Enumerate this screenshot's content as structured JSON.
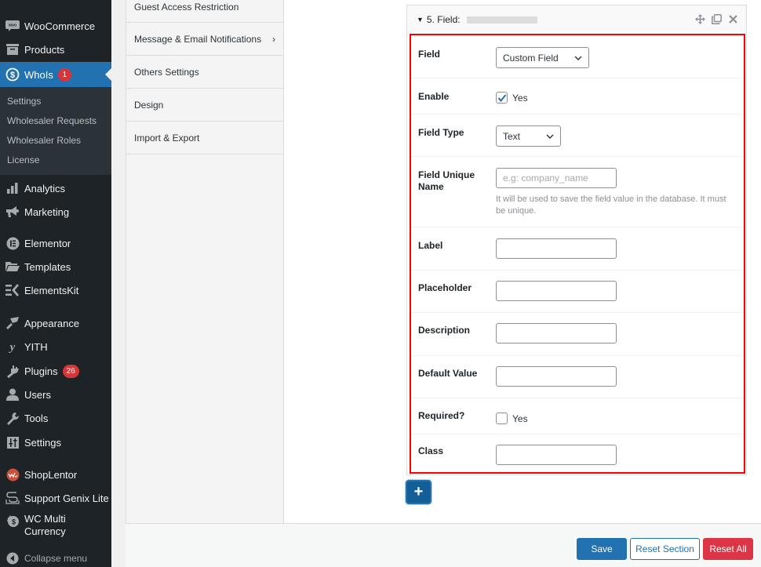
{
  "sidebar": {
    "items": [
      {
        "label": "WooCommerce",
        "icon": "woocommerce-icon"
      },
      {
        "label": "Products",
        "icon": "archive-box-icon"
      },
      {
        "label": "WhoIs",
        "icon": "dollar-circle-icon",
        "badge": "1",
        "active": true
      },
      {
        "label": "Analytics",
        "icon": "bar-chart-icon"
      },
      {
        "label": "Marketing",
        "icon": "megaphone-icon"
      },
      {
        "label": "Elementor",
        "icon": "elementor-icon"
      },
      {
        "label": "Templates",
        "icon": "folder-open-icon"
      },
      {
        "label": "ElementsKit",
        "icon": "elementskit-icon"
      },
      {
        "label": "Appearance",
        "icon": "paintbrush-icon"
      },
      {
        "label": "YITH",
        "icon": "yith-icon"
      },
      {
        "label": "Plugins",
        "icon": "plug-icon",
        "badge": "26"
      },
      {
        "label": "Users",
        "icon": "user-icon"
      },
      {
        "label": "Tools",
        "icon": "wrench-icon"
      },
      {
        "label": "Settings",
        "icon": "sliders-icon"
      },
      {
        "label": "ShopLentor",
        "icon": "shoplentor-icon"
      },
      {
        "label": "Support Genix Lite",
        "icon": "support-genix-icon"
      },
      {
        "label": "WC Multi Currency",
        "icon": "wc-multi-currency-icon"
      }
    ],
    "submenu": [
      "Settings",
      "Wholesaler Requests",
      "Wholesaler Roles",
      "License"
    ],
    "collapse_label": "Collapse menu"
  },
  "settings_nav": {
    "items": [
      {
        "label": "Guest Access Restriction"
      },
      {
        "label": "Message & Email Notifications",
        "has_children": true
      },
      {
        "label": "Others Settings"
      },
      {
        "label": "Design"
      },
      {
        "label": "Import & Export"
      }
    ]
  },
  "field_card": {
    "title": "5. Field:",
    "actions": [
      "move-icon",
      "duplicate-icon",
      "close-icon"
    ],
    "rows": {
      "field": {
        "label": "Field",
        "value": "Custom Field"
      },
      "enable": {
        "label": "Enable",
        "option": "Yes",
        "checked": true
      },
      "field_type": {
        "label": "Field Type",
        "value": "Text"
      },
      "unique_name": {
        "label": "Field Unique Name",
        "placeholder": "e.g: company_name",
        "value": "",
        "help": "It will be used to save the field value in the database. It must be unique."
      },
      "label": {
        "label": "Label",
        "value": ""
      },
      "placeholder": {
        "label": "Placeholder",
        "value": ""
      },
      "description": {
        "label": "Description",
        "value": ""
      },
      "default_value": {
        "label": "Default Value",
        "value": ""
      },
      "required": {
        "label": "Required?",
        "option": "Yes",
        "checked": false
      },
      "class": {
        "label": "Class",
        "value": ""
      }
    },
    "add_button": "+"
  },
  "footer": {
    "save": "Save",
    "reset_section": "Reset Section",
    "reset_all": "Reset All"
  },
  "colors": {
    "accent": "#2271b1",
    "highlight_border": "#ff0000",
    "danger": "#dc3545",
    "badge": "#d63638",
    "sidebar_bg": "#1d2327"
  }
}
